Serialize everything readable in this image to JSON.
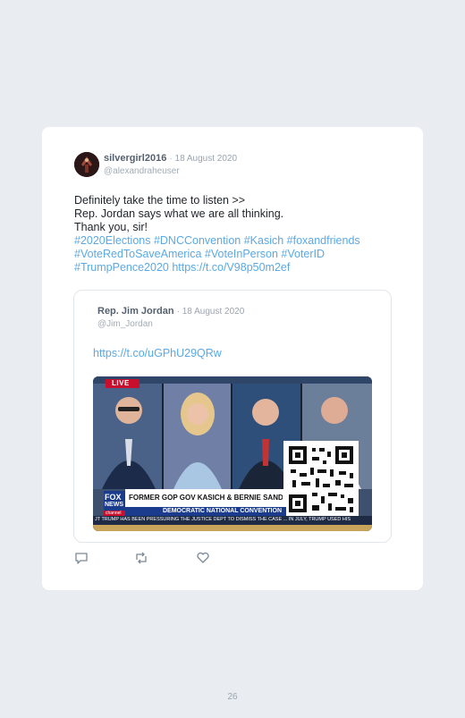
{
  "tweet": {
    "author_name": "silvergirl2016",
    "date": "· 18 August 2020",
    "handle": "@alexandraheuser",
    "lines": [
      "Definitely take the time to listen >>",
      "Rep. Jordan says what we are all thinking.",
      "Thank you, sir!"
    ],
    "hashtag_lines": [
      "#2020Elections #DNCConvention #Kasich #foxandfriends",
      "#VoteRedToSaveAmerica #VoteInPerson #VoterID",
      "#TrumpPence2020 https://t.co/V98p50m2ef"
    ]
  },
  "quoted": {
    "author_name": "Rep. Jim Jordan",
    "date": "· 18 August 2020",
    "handle": "@Jim_Jordan",
    "link": "https://t.co/uGPhU29QRw",
    "media": {
      "live_badge": "LIVE",
      "network_logo_top": "FOX",
      "network_logo_bottom": "NEWS",
      "network_logo_sub": "channel",
      "headline": "FORMER GOP GOV KASICH & BERNIE SANDERS ADDR",
      "subheadline": "DEMOCRATIC NATIONAL CONVENTION",
      "ticker": "JT TRUMP HAS BEEN PRESSURING THE JUSTICE DEPT TO DISMISS THE CASE ... IN JULY, TRUMP USED HIS"
    }
  },
  "actions": {
    "reply_icon": "reply-icon",
    "retweet_icon": "retweet-icon",
    "like_icon": "like-icon"
  },
  "page": {
    "number": "26"
  },
  "colors": {
    "background": "#e9edf1",
    "card": "#ffffff",
    "link": "#5aa9e6",
    "muted": "#9aa4ae",
    "fox_red": "#c8102e",
    "fox_blue": "#1b3c8c"
  }
}
